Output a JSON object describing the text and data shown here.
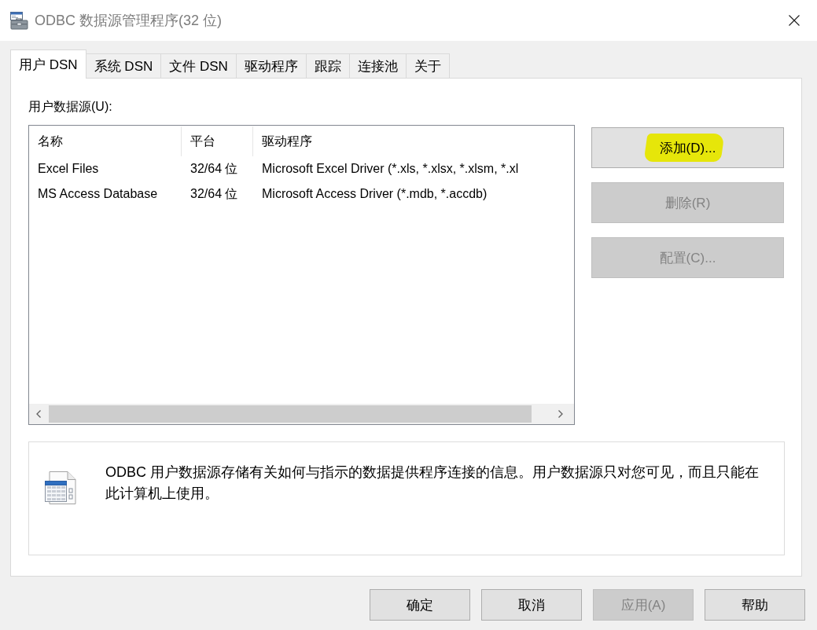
{
  "window": {
    "title": "ODBC 数据源管理程序(32 位)"
  },
  "tabs": [
    {
      "label": "用户 DSN",
      "selected": true
    },
    {
      "label": "系统 DSN",
      "selected": false
    },
    {
      "label": "文件 DSN",
      "selected": false
    },
    {
      "label": "驱动程序",
      "selected": false
    },
    {
      "label": "跟踪",
      "selected": false
    },
    {
      "label": "连接池",
      "selected": false
    },
    {
      "label": "关于",
      "selected": false
    }
  ],
  "data_sources": {
    "label": "用户数据源(U):",
    "columns": [
      "名称",
      "平台",
      "驱动程序"
    ],
    "rows": [
      {
        "cells": [
          "Excel Files",
          "32/64 位",
          "Microsoft Excel Driver (*.xls, *.xlsx, *.xlsm, *.xl"
        ]
      },
      {
        "cells": [
          "MS Access Database",
          "32/64 位",
          "Microsoft Access Driver (*.mdb, *.accdb)"
        ]
      }
    ]
  },
  "side_buttons": [
    {
      "label": "添加(D)...",
      "disabled": false,
      "highlighted": true
    },
    {
      "label": "删除(R)",
      "disabled": true,
      "highlighted": false
    },
    {
      "label": "配置(C)...",
      "disabled": true,
      "highlighted": false
    }
  ],
  "info": {
    "text": "ODBC 用户数据源存储有关如何与指示的数据提供程序连接的信息。用户数据源只对您可见，而且只能在此计算机上使用。"
  },
  "footer_buttons": [
    {
      "label": "确定",
      "disabled": false
    },
    {
      "label": "取消",
      "disabled": false
    },
    {
      "label": "应用(A)",
      "disabled": true
    },
    {
      "label": "帮助",
      "disabled": false
    }
  ]
}
